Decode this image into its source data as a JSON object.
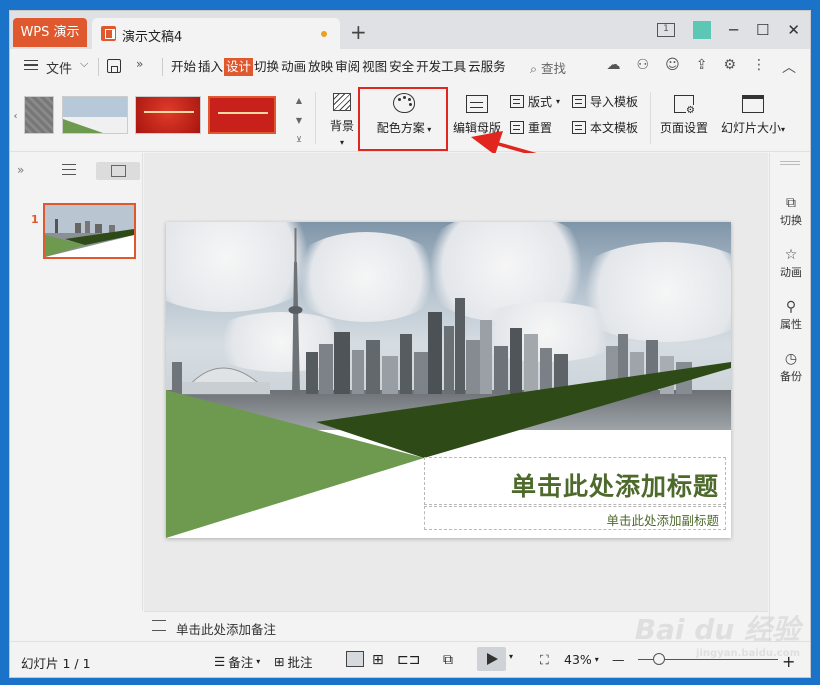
{
  "titlebar": {
    "app_tab": "WPS 演示",
    "doc_tab": "演示文稿4",
    "new_tab": "+",
    "window_count": "1",
    "minimize": "─",
    "maximize": "☐",
    "close": "✕"
  },
  "menubar": {
    "file": "文件",
    "tabs": [
      "开始",
      "插入",
      "设计",
      "切换",
      "动画",
      "放映",
      "审阅",
      "视图",
      "安全",
      "开发工具",
      "云服务"
    ],
    "active_tab": "设计",
    "search": "查找"
  },
  "ribbon": {
    "background": "背景",
    "color_scheme": "配色方案",
    "edit_master": "编辑母版",
    "layout": "版式",
    "reset": "重置",
    "import_template": "导入模板",
    "text_template": "本文模板",
    "page_setup": "页面设置",
    "slide_size": "幻灯片大小"
  },
  "left_panel": {
    "slide_number": "1"
  },
  "slide": {
    "title": "单击此处添加标题",
    "subtitle": "单击此处添加副标题"
  },
  "notes": {
    "placeholder": "单击此处添加备注"
  },
  "right_rail": {
    "items": [
      "切换",
      "动画",
      "属性",
      "备份"
    ]
  },
  "status": {
    "slide_indicator": "幻灯片 1 / 1",
    "notes": "备注",
    "comment": "批注",
    "zoom": "43%"
  },
  "watermark": {
    "text": "Bai du 经验",
    "url": "jingyan.baidu.com"
  },
  "colors": {
    "accent": "#e0582e",
    "highlight": "#e0261e",
    "slide_green": "#6d9a4e",
    "slide_dark_green": "#2e4a17",
    "title_green": "#4d6a2c"
  }
}
